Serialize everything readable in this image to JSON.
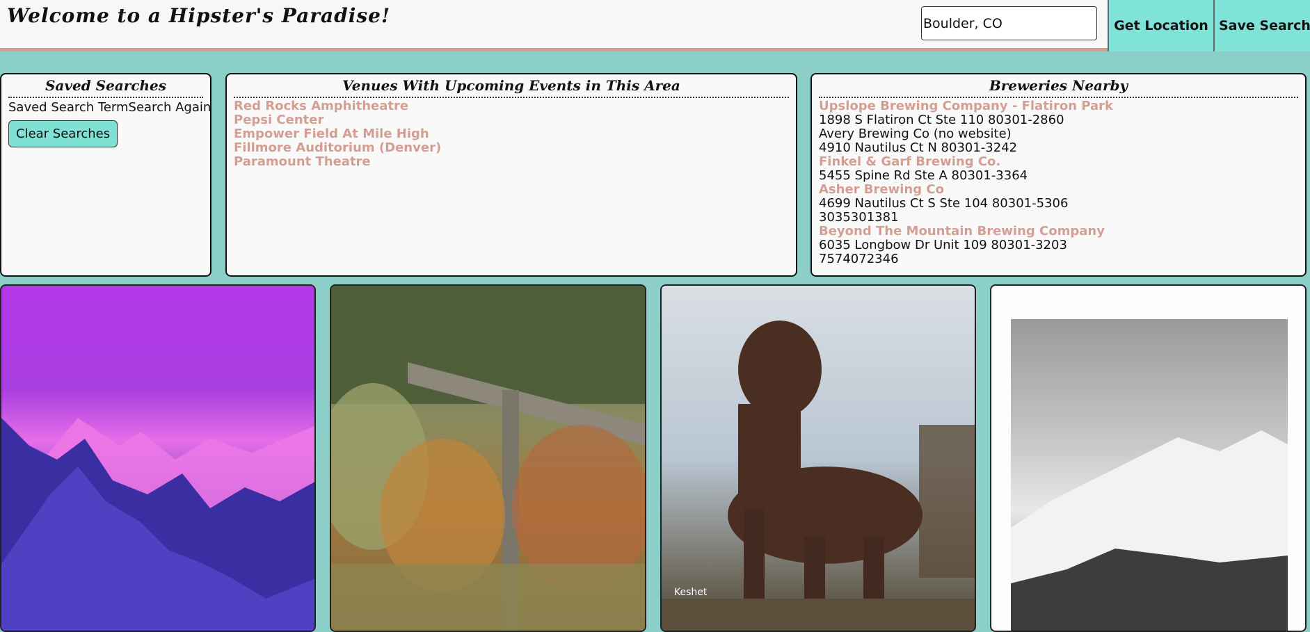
{
  "header": {
    "title": "Welcome to a Hipster's Paradise!",
    "search_value": "Boulder, CO",
    "get_location_label": "Get Location",
    "save_search_label": "Save Search"
  },
  "saved": {
    "title": "Saved Searches",
    "column_term": "Saved Search Term",
    "column_again": "Search Again",
    "clear_label": "Clear Searches"
  },
  "venues": {
    "title": "Venues With Upcoming Events in This Area",
    "items": [
      "Red Rocks Amphitheatre",
      "Pepsi Center",
      "Empower Field At Mile High",
      "Fillmore Auditorium (Denver)",
      "Paramount Theatre"
    ]
  },
  "breweries": {
    "title": "Breweries Nearby",
    "items": [
      {
        "name": "Upslope Brewing Company - Flatiron Park",
        "linked": true,
        "address": "1898 S Flatiron Ct Ste 110 80301-2860",
        "phone": ""
      },
      {
        "name": "Avery Brewing Co (no website)",
        "linked": false,
        "address": "4910 Nautilus Ct N 80301-3242",
        "phone": ""
      },
      {
        "name": "Finkel & Garf Brewing Co.",
        "linked": true,
        "address": "5455 Spine Rd Ste A 80301-3364",
        "phone": ""
      },
      {
        "name": "Asher Brewing Co",
        "linked": true,
        "address": "4699 Nautilus Ct S Ste 104 80301-5306",
        "phone": "3035301381"
      },
      {
        "name": "Beyond The Mountain Brewing Company",
        "linked": true,
        "address": "6035 Longbow Dr Unit 109 80301-3203",
        "phone": "7574072346"
      }
    ]
  },
  "photos": {
    "watermark": "Keshet"
  }
}
